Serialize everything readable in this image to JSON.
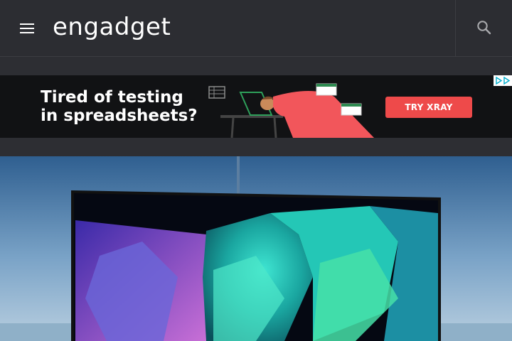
{
  "header": {
    "logo": "engadget",
    "menu_icon": "hamburger-menu-icon",
    "search_icon": "search-icon"
  },
  "ad": {
    "headline_line1": "Tired of testing",
    "headline_line2": "in spreadsheets?",
    "cta_label": "TRY XRAY",
    "choices_icon": "ad-choices-icon"
  },
  "hero": {
    "image_description_icon": "tv-product-image"
  },
  "colors": {
    "header_bg": "#2c2d32",
    "ad_bg": "#111214",
    "cta": "#ee4a4a"
  }
}
